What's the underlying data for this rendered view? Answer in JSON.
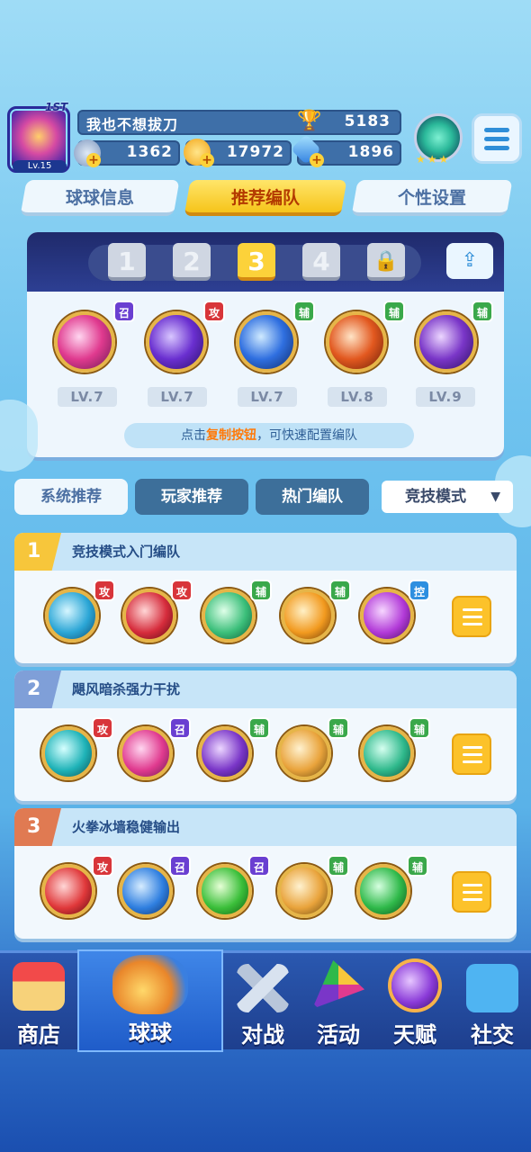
{
  "player": {
    "name": "我也不想拔刀",
    "level": "Lv.15",
    "rank_badge": "1ST",
    "trophies": "5183",
    "stamina": "1362",
    "gold": "17972",
    "gems": "1896"
  },
  "tabs": [
    "球球信息",
    "推荐编队",
    "个性设置"
  ],
  "active_tab": 1,
  "slots": [
    "1",
    "2",
    "3",
    "4"
  ],
  "active_slot": 2,
  "current_team": [
    {
      "badge": "召",
      "level": "LV.7",
      "icon": "phoenix-orb-icon",
      "color": "#e03a8f"
    },
    {
      "badge": "攻",
      "level": "LV.7",
      "icon": "sword-orb-icon",
      "color": "#6a2fd0"
    },
    {
      "badge": "辅",
      "level": "LV.7",
      "icon": "crown-orb-icon",
      "color": "#2f6fe0"
    },
    {
      "badge": "辅",
      "level": "LV.8",
      "icon": "wings-orb-icon",
      "color": "#e2581f"
    },
    {
      "badge": "辅",
      "level": "LV.9",
      "icon": "feather-orb-icon",
      "color": "#7a36c8"
    }
  ],
  "hint": {
    "prefix": "点击",
    "highlight": "复制按钮",
    "suffix": "，可快速配置编队"
  },
  "filters": [
    "系统推荐",
    "玩家推荐",
    "热门编队"
  ],
  "mode": "竞技模式",
  "recommended": [
    {
      "num": "1",
      "title": "竞技模式入门编队",
      "color": "#f7c63b",
      "orbs": [
        {
          "badge": "攻",
          "icon": "whirlpool-orb-icon",
          "color": "#2ba6d6"
        },
        {
          "badge": "攻",
          "icon": "lightning-orb-icon",
          "color": "#d62c3c"
        },
        {
          "badge": "辅",
          "icon": "sp-orb-icon",
          "color": "#3bbf7a"
        },
        {
          "badge": "辅",
          "icon": "pumpkin-orb-icon",
          "color": "#f29a1f"
        },
        {
          "badge": "控",
          "icon": "cloud-orb-icon",
          "color": "#b23ad8"
        }
      ]
    },
    {
      "num": "2",
      "title": "飓风暗杀强力干扰",
      "color": "#7f9fd8",
      "orbs": [
        {
          "badge": "攻",
          "icon": "tornado-orb-icon",
          "color": "#1fb3b8"
        },
        {
          "badge": "召",
          "icon": "blade-orb-icon",
          "color": "#e03a8f"
        },
        {
          "badge": "辅",
          "icon": "feather-orb-icon",
          "color": "#7a36c8"
        },
        {
          "badge": "辅",
          "icon": "figures-orb-icon",
          "color": "#e9a33b"
        },
        {
          "badge": "辅",
          "icon": "sp-orb-icon",
          "color": "#2fb98c"
        }
      ]
    },
    {
      "num": "3",
      "title": "火拳冰墙稳健输出",
      "color": "#e07a52",
      "orbs": [
        {
          "badge": "攻",
          "icon": "fist-orb-icon",
          "color": "#e0383a"
        },
        {
          "badge": "召",
          "icon": "ice-wall-orb-icon",
          "color": "#2f7fe0"
        },
        {
          "badge": "召",
          "icon": "hexagon-orb-icon",
          "color": "#3bbf3a"
        },
        {
          "badge": "辅",
          "icon": "figures-orb-icon",
          "color": "#e9a33b"
        },
        {
          "badge": "辅",
          "icon": "arrow-orb-icon",
          "color": "#2fb94a"
        }
      ]
    }
  ],
  "nav": [
    "商店",
    "球球",
    "对战",
    "活动",
    "天赋",
    "社交"
  ],
  "active_nav": 1
}
